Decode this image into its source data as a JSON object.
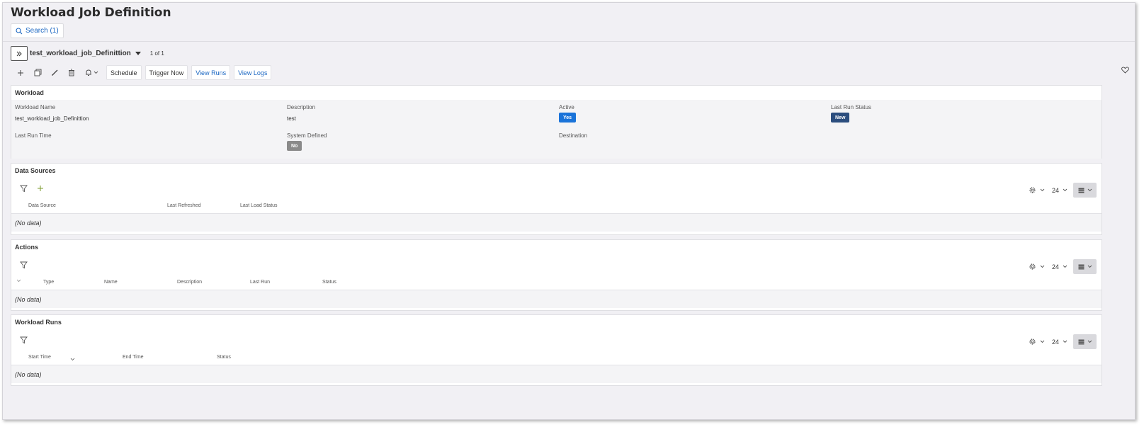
{
  "page": {
    "title": "Workload Job Definition"
  },
  "search": {
    "label": "Search (1)"
  },
  "record": {
    "name": "test_workload_job_Definittion",
    "count": "1 of 1"
  },
  "toolbar": {
    "icons": [
      "plus-icon",
      "copy-icon",
      "pencil-icon",
      "trash-icon",
      "bell-icon"
    ],
    "buttons": {
      "schedule": "Schedule",
      "trigger_now": "Trigger Now",
      "view_runs": "View Runs",
      "view_logs": "View Logs"
    }
  },
  "workload": {
    "title": "Workload",
    "fields": {
      "workload_name": {
        "label": "Workload Name",
        "value": "test_workload_job_Definittion"
      },
      "description": {
        "label": "Description",
        "value": "test"
      },
      "active": {
        "label": "Active",
        "value": "Yes"
      },
      "last_run_status": {
        "label": "Last Run Status",
        "value": "New"
      },
      "last_run_time": {
        "label": "Last Run Time",
        "value": ""
      },
      "system_defined": {
        "label": "System Defined",
        "value": "No"
      },
      "destination": {
        "label": "Destination",
        "value": ""
      }
    }
  },
  "data_sources": {
    "title": "Data Sources",
    "page_size": "24",
    "columns": [
      "Data Source",
      "Last Refreshed",
      "Last Load Status"
    ],
    "empty_text": "(No data)"
  },
  "actions": {
    "title": "Actions",
    "page_size": "24",
    "columns": [
      "Type",
      "Name",
      "Description",
      "Last Run",
      "Status"
    ],
    "empty_text": "(No data)"
  },
  "workload_runs": {
    "title": "Workload Runs",
    "page_size": "24",
    "columns": [
      "Start Time",
      "End Time",
      "Status"
    ],
    "empty_text": "(No data)"
  },
  "colors": {
    "accent_blue": "#1a66c2",
    "badge_yes": "#1a73d9",
    "badge_new": "#2b4d7e",
    "badge_no": "#8a8a8a"
  }
}
